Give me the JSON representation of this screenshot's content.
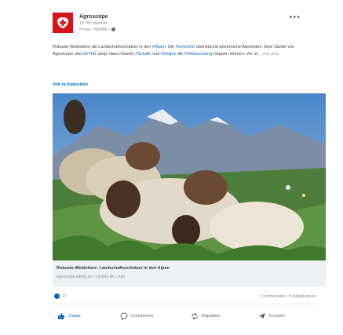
{
  "post": {
    "author": "Agroscope",
    "followers": "13 760 abonnés",
    "meta": "8 mois • Modifié •",
    "text_parts": [
      "Robuste Weidetiere als Landschaftsschützer in den ",
      "#Alpen",
      ": Die ",
      "#Grünerle",
      " überwächst artenreiche Alpweiden. Eine Studie von Agroscope und ",
      "#ETHZ",
      " zeigt, dass robuste ",
      "#Schafe",
      " und ",
      "#Ziegen",
      " die ",
      "#Verbuschung",
      " stoppen können. Vor al"
    ],
    "see_more": "…voir plus",
    "translate": "Voir la traduction"
  },
  "link": {
    "title": "Robuste Weidetiere: Landschaftsschützer in den Alpen",
    "source": "agroscope.admin.ch • Lecture de 1 min"
  },
  "social": {
    "reactions": "27",
    "counts": "1 commentaire • 8 republications"
  },
  "actions": {
    "like": "J'aime",
    "comment": "Commenter",
    "repost": "Republier",
    "send": "Envoyer"
  },
  "colors": {
    "accent": "#0a66c2",
    "logo_red": "#d7141a"
  },
  "icons": [
    "swiss-cross-icon",
    "more-icon",
    "globe-icon",
    "like-icon",
    "comment-icon",
    "repost-icon",
    "send-icon"
  ]
}
